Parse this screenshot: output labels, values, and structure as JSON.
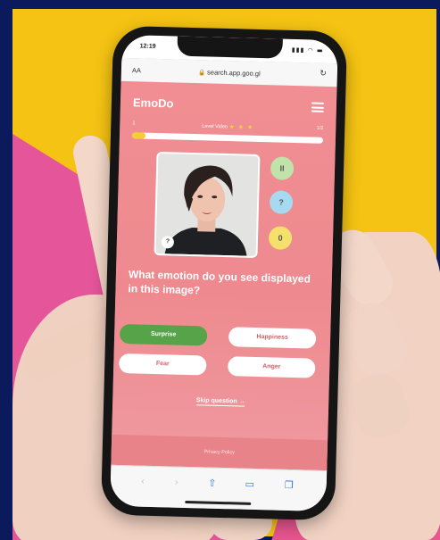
{
  "status_bar": {
    "time": "12:19",
    "icons": "▮▮▮ ◠ ▬"
  },
  "browser": {
    "aa_label": "AA",
    "url": "search.app.goo.gl",
    "reload_icon": "↻"
  },
  "app": {
    "logo": "EmoDo",
    "level": {
      "left": "1",
      "center": "Level Video",
      "stars": "★ ★ ★",
      "right": "1/2",
      "progress_fraction": 0.07
    },
    "side_buttons": {
      "pause": "II",
      "help": "?",
      "zero": "0"
    },
    "help_badge": "?",
    "question": "What emotion do you see displayed in this image?",
    "answers": [
      {
        "label": "Surprise",
        "selected": true
      },
      {
        "label": "Happiness",
        "selected": false
      },
      {
        "label": "Fear",
        "selected": false
      },
      {
        "label": "Anger",
        "selected": false
      }
    ],
    "skip_label": "Skip question →",
    "privacy_label": "Privacy Policy"
  },
  "toolbar": {
    "back": "‹",
    "forward": "›",
    "share": "⇧",
    "bookmarks": "▭",
    "tabs": "❐"
  },
  "colors": {
    "background_yellow": "#f4c313",
    "background_magenta": "#e5559a",
    "app_pink": "#ee8a8f",
    "selected_green": "#56a34a"
  }
}
